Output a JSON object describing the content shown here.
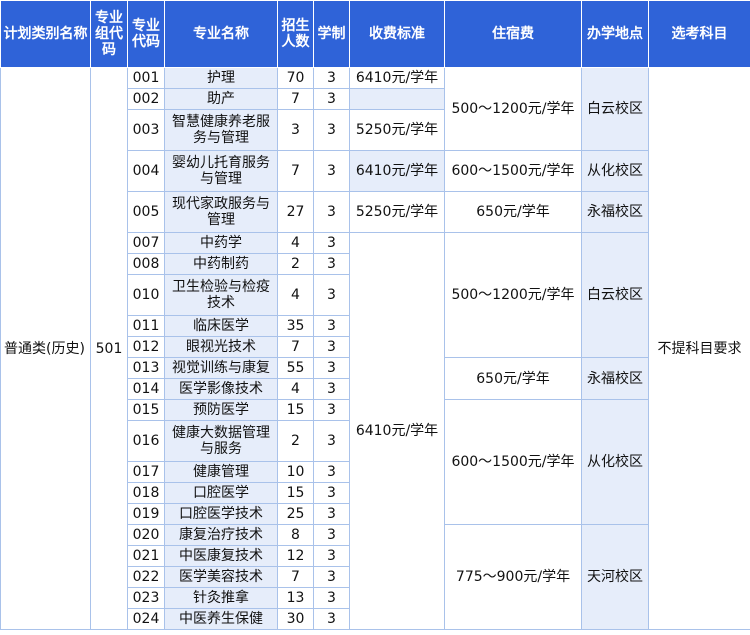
{
  "headers": {
    "category": "计划类别名称",
    "group_code": "专业组代码",
    "major_code": "专业代码",
    "major_name": "专业名称",
    "enrollment": "招生人数",
    "duration": "学制",
    "tuition": "收费标准",
    "lodging": "住宿费",
    "campus": "办学地点",
    "subject_req": "选考科目"
  },
  "category": "普通类(历史)",
  "group_code": "501",
  "subject_req": "不提科目要求",
  "rows": [
    {
      "code": "001",
      "name": "护理",
      "count": "70",
      "years": "3"
    },
    {
      "code": "002",
      "name": "助产",
      "count": "7",
      "years": "3"
    },
    {
      "code": "003",
      "name": "智慧健康养老服务与管理",
      "count": "3",
      "years": "3"
    },
    {
      "code": "004",
      "name": "婴幼儿托育服务与管理",
      "count": "7",
      "years": "3"
    },
    {
      "code": "005",
      "name": "现代家政服务与管理",
      "count": "27",
      "years": "3"
    },
    {
      "code": "007",
      "name": "中药学",
      "count": "4",
      "years": "3"
    },
    {
      "code": "008",
      "name": "中药制药",
      "count": "2",
      "years": "3"
    },
    {
      "code": "010",
      "name": "卫生检验与检疫技术",
      "count": "4",
      "years": "3"
    },
    {
      "code": "011",
      "name": "临床医学",
      "count": "35",
      "years": "3"
    },
    {
      "code": "012",
      "name": "眼视光技术",
      "count": "7",
      "years": "3"
    },
    {
      "code": "013",
      "name": "视觉训练与康复",
      "count": "55",
      "years": "3"
    },
    {
      "code": "014",
      "name": "医学影像技术",
      "count": "4",
      "years": "3"
    },
    {
      "code": "015",
      "name": "预防医学",
      "count": "15",
      "years": "3"
    },
    {
      "code": "016",
      "name": "健康大数据管理与服务",
      "count": "2",
      "years": "3"
    },
    {
      "code": "017",
      "name": "健康管理",
      "count": "10",
      "years": "3"
    },
    {
      "code": "018",
      "name": "口腔医学",
      "count": "15",
      "years": "3"
    },
    {
      "code": "019",
      "name": "口腔医学技术",
      "count": "25",
      "years": "3"
    },
    {
      "code": "020",
      "name": "康复治疗技术",
      "count": "8",
      "years": "3"
    },
    {
      "code": "021",
      "name": "中医康复技术",
      "count": "12",
      "years": "3"
    },
    {
      "code": "022",
      "name": "医学美容技术",
      "count": "7",
      "years": "3"
    },
    {
      "code": "023",
      "name": "针灸推拿",
      "count": "13",
      "years": "3"
    },
    {
      "code": "024",
      "name": "中医养生保健",
      "count": "30",
      "years": "3"
    }
  ],
  "tuition": [
    "6410元/学年",
    "5250元/学年",
    "6410元/学年",
    "5250元/学年",
    "6410元/学年"
  ],
  "lodging": [
    "500～1200元/学年",
    "600～1500元/学年",
    "650元/学年",
    "500～1200元/学年",
    "650元/学年",
    "600～1500元/学年",
    "775～900元/学年"
  ],
  "campus": [
    "白云校区",
    "从化校区",
    "永福校区",
    "白云校区",
    "永福校区",
    "从化校区",
    "天河校区"
  ],
  "colors": {
    "header_bg": "#2f63d8",
    "header_text": "#ffffff",
    "grid": "#a9c2ea",
    "shade": "#e6edfa"
  }
}
